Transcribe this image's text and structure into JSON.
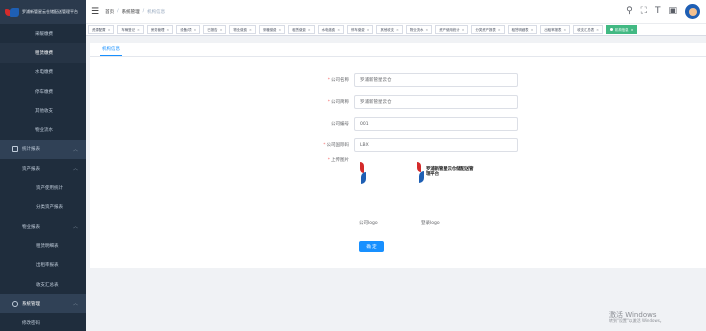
{
  "brand": {
    "title": "罗浦新管星云仓储配送管理平台"
  },
  "sidebar": {
    "items": [
      {
        "label": "采暖缴费"
      },
      {
        "label": "租赁缴费"
      },
      {
        "label": "水电缴费"
      },
      {
        "label": "停车缴费"
      },
      {
        "label": "其他收支"
      },
      {
        "label": "物业流水"
      }
    ],
    "stats": {
      "label": "统计报表"
    },
    "asset": {
      "label": "资产报表",
      "items": [
        {
          "label": "资产使用统计"
        },
        {
          "label": "分类资产报表"
        }
      ]
    },
    "property": {
      "label": "物业报表",
      "items": [
        {
          "label": "租赁明细表"
        },
        {
          "label": "出租率报表"
        },
        {
          "label": "收支汇总表"
        }
      ]
    },
    "system": {
      "label": "系统管理"
    },
    "password": {
      "label": "修改密码"
    }
  },
  "breadcrumb": {
    "home": "首页",
    "system": "系统管理",
    "current": "机构信息",
    "sep": "/"
  },
  "tags": [
    {
      "label": "资源配置"
    },
    {
      "label": "车辆登记"
    },
    {
      "label": "房务管理"
    },
    {
      "label": "设备/项"
    },
    {
      "label": "已报告"
    },
    {
      "label": "物业缴费"
    },
    {
      "label": "采暖缴费"
    },
    {
      "label": "租赁缴费"
    },
    {
      "label": "水电缴费"
    },
    {
      "label": "停车缴费"
    },
    {
      "label": "其他收支"
    },
    {
      "label": "物业流水"
    },
    {
      "label": "资产使用统计"
    },
    {
      "label": "分类资产报表"
    },
    {
      "label": "租赁明细表"
    },
    {
      "label": "出租率报表"
    },
    {
      "label": "收支汇总表"
    },
    {
      "label": "机构信息",
      "active": true
    }
  ],
  "tab": {
    "label": "机构信息"
  },
  "form": {
    "name": {
      "label": "公司名称",
      "value": "罗浦新管星云仓"
    },
    "abbr": {
      "label": "公司简称",
      "value": "罗浦新管星云仓"
    },
    "code": {
      "label": "公司编号",
      "value": "001"
    },
    "intl": {
      "label": "公司国际码",
      "value": "LBX"
    },
    "upload": {
      "label": "上传图片"
    }
  },
  "uploads": {
    "logo_text": "罗浦新管星云仓储配送管理平台",
    "captions": [
      "公司logo",
      "登录logo"
    ]
  },
  "confirm": {
    "label": "确 定"
  },
  "watermark": {
    "line1": "激活 Windows",
    "line2": "转到\"设置\"以激活 Windows。"
  }
}
